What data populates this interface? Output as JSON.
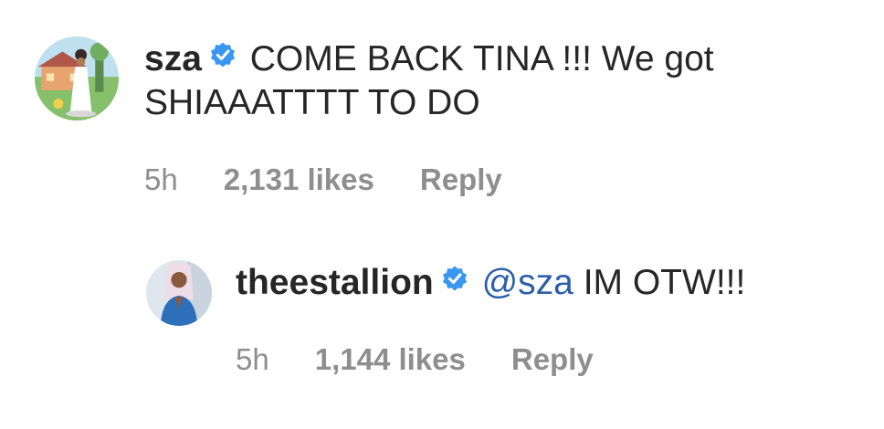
{
  "comments": [
    {
      "username": "sza",
      "verified_icon": "verified-badge-icon",
      "text": "COME BACK TINA !!! We got SHIAAATTTT TO DO",
      "time": "5h",
      "likes": "2,131 likes",
      "reply_label": "Reply"
    },
    {
      "username": "theestallion",
      "verified_icon": "verified-badge-icon",
      "mention": "@sza",
      "text": "IM OTW!!!",
      "time": "5h",
      "likes": "1,144 likes",
      "reply_label": "Reply"
    }
  ],
  "colors": {
    "text": "#262626",
    "secondary": "#8e8e8e",
    "verified": "#3897f0",
    "mention": "#2b5fa8"
  }
}
